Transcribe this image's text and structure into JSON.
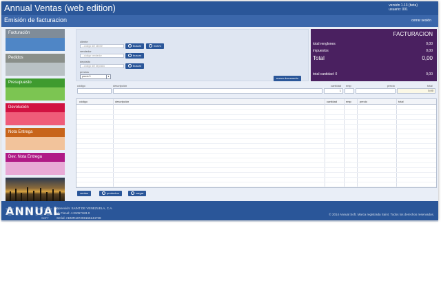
{
  "app": {
    "title": "Annual Ventas (web edition)",
    "version_line": "versión 1.13 (beta)",
    "user_line": "usuario: 001"
  },
  "header": {
    "module_title": "Emisión de facturacion",
    "close_label": "cerrar sesión"
  },
  "sidebar": {
    "items": [
      {
        "label": "Facturación",
        "head_color": "#7f8c99",
        "body_color": "#4f86c6"
      },
      {
        "label": "Pedidos",
        "head_color": "#8a8f8a",
        "body_color": "#b9c1c4"
      },
      {
        "label": "Presupuesto",
        "head_color": "#3f9b2f",
        "body_color": "#7cc552"
      },
      {
        "label": "Devolución",
        "head_color": "#d11241",
        "body_color": "#ef5c79"
      },
      {
        "label": "Nota Entrega",
        "head_color": "#c8641a",
        "body_color": "#f2c39b"
      },
      {
        "label": "Dev. Nota Entrega",
        "head_color": "#b01a86",
        "body_color": "#e8aad6"
      }
    ]
  },
  "form": {
    "cliente_label": "cliente",
    "cliente_placeholder": "...código del cliente",
    "vendedor_label": "vendedor",
    "vendedor_placeholder": "...código vendedor",
    "deposito_label": "depósito",
    "deposito_placeholder": "...código del depósito",
    "precios_label": "precios",
    "precio_selected": "precio 3",
    "buscar_label": "buscar",
    "nuevo_label": "nuevo",
    "nuevo_documento_label": "nuevo documento"
  },
  "totals": {
    "title": "FACTURACION",
    "total_renglones_label": "total renglones",
    "total_renglones_value": "0,00",
    "impuestos_label": "impuestos",
    "impuestos_value": "0,00",
    "total_label": "Total",
    "total_value": "0,00",
    "total_cantidad_label": "total cantidad: 0",
    "total_cantidad_value": "0,00"
  },
  "entry": {
    "codigo_label": "código",
    "descripcion_label": "descripción",
    "cantidad_label": "cantidad",
    "cantidad_value": "1",
    "emp_label": "emp",
    "precio_label": "precio",
    "total_label": "total",
    "total_value": "0,00"
  },
  "grid": {
    "columns": [
      "código",
      "descripción",
      "cantidad",
      "emp",
      "precio",
      "total"
    ]
  },
  "actions": {
    "ventas_label": "ventas",
    "productos_label": "productos",
    "cargar_label": "cargar"
  },
  "footer": {
    "logo_text": "ANNUAL",
    "logo_sub": "SOFT",
    "company_name": "Conexión: SAINT DE VENEZUELA, C.A.",
    "fiscal_id": "Id. Fiscal: J-31057183-0",
    "serial": "Serial: ADMR187259156144708",
    "copyright": "© 2014 Annual Soft. Marca registrada Saint. Todos los derechos reservados."
  }
}
